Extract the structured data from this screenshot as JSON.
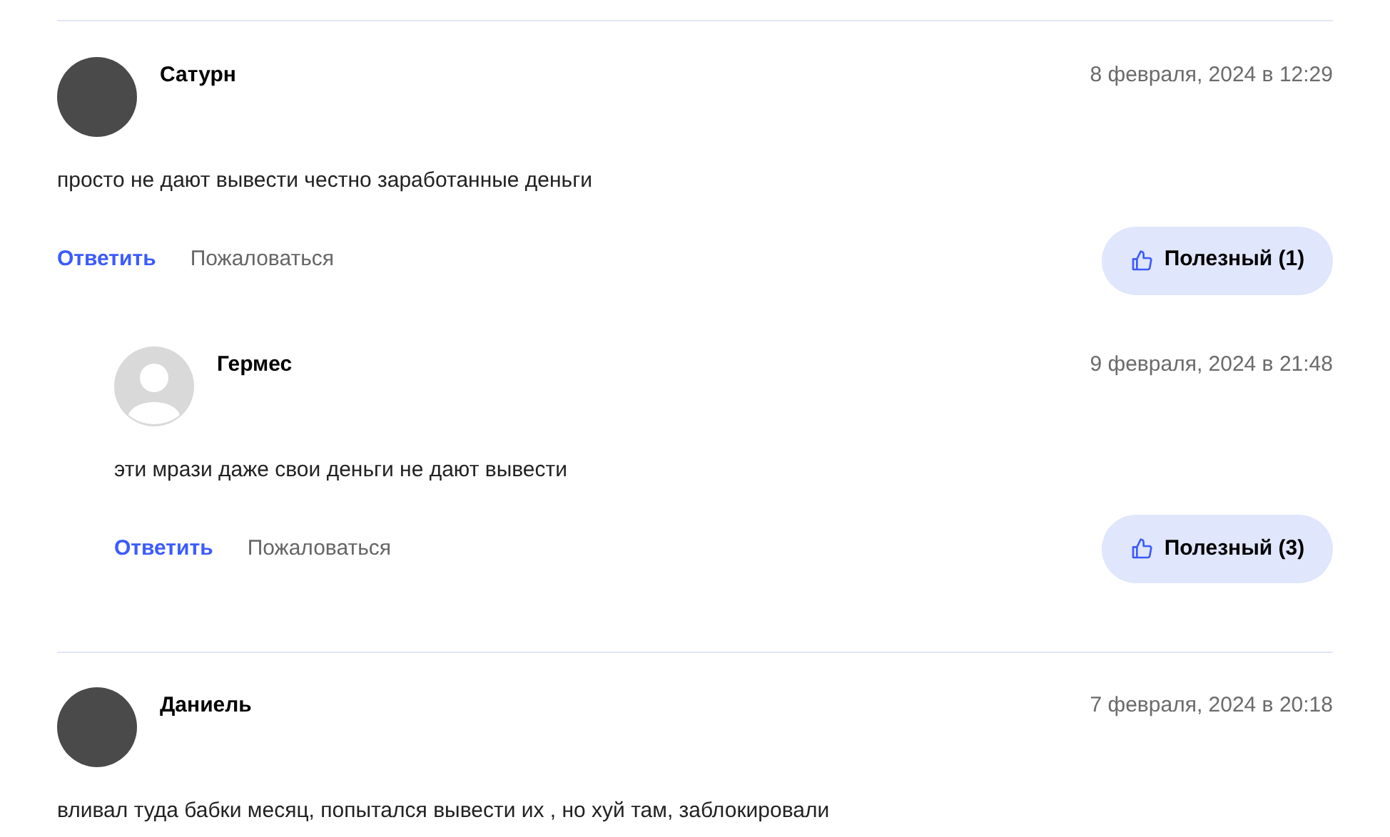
{
  "comments": [
    {
      "author": "Сатурн",
      "avatar": {
        "kind": "photo"
      },
      "date": "8 февраля, 2024 в 12:29",
      "text": "просто не дают вывести честно заработанные деньги",
      "reply": "Ответить",
      "report": "Пожаловаться",
      "helpful": "Полезный (1)",
      "children": [
        {
          "author": "Гермес",
          "avatar": {
            "kind": "default"
          },
          "date": "9 февраля, 2024 в 21:48",
          "text": "эти мрази даже свои деньги не дают вывести",
          "reply": "Ответить",
          "report": "Пожаловаться",
          "helpful": "Полезный (3)"
        }
      ]
    },
    {
      "author": "Даниель",
      "avatar": {
        "kind": "photo"
      },
      "date": "7 февраля, 2024 в 20:18",
      "text": "вливал туда бабки месяц, попытался вывести их , но хуй там, заблокировали"
    }
  ]
}
